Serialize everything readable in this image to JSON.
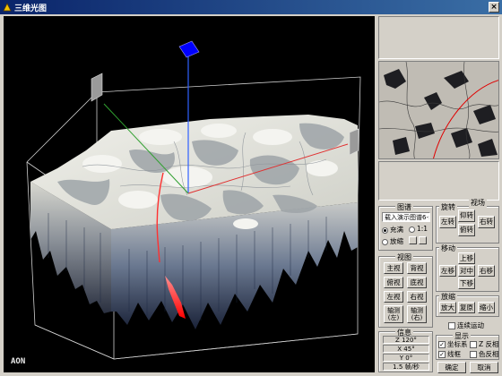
{
  "window": {
    "title": "三维光图",
    "min_glyph": "_",
    "max_glyph": "□",
    "close_glyph": "×"
  },
  "viewport": {
    "corner_label": "AON"
  },
  "colors": {
    "title_bar": "#0a246a",
    "surface": "#e2e0d8",
    "axis_x": "#e03030",
    "axis_y": "#30a030",
    "axis_z": "#3060ff",
    "marker": "#0000ff"
  },
  "controls": {
    "map_group": {
      "label": "图谱",
      "selected_map": "载入演示图谱6->",
      "fill_label": "充满",
      "ratio_label": "1:1",
      "zoom_label": "放缩",
      "fill_selected": true
    },
    "rotate_group": {
      "label": "旋转",
      "left": "左转",
      "up": "仰转",
      "right": "右转",
      "down": "俯转"
    },
    "field_label": "视场",
    "move_group": {
      "label": "移动",
      "up": "上移",
      "left": "左移",
      "center": "对中",
      "right": "右移",
      "down": "下移"
    },
    "view_group": {
      "label": "视图",
      "front": "主视",
      "back": "背视",
      "top": "俯视",
      "bottom": "底视",
      "left": "左视",
      "right": "右视",
      "iso_left": [
        "轴测",
        "(左)"
      ],
      "iso_right": [
        "轴测",
        "(右)"
      ]
    },
    "zoom_group": {
      "label": "放缩",
      "enlarge": "放大",
      "reset": "复原",
      "shrink": "缩小"
    },
    "continuous_label": "连续运动",
    "info_group": {
      "label": "信息",
      "rows": [
        "Z 120°",
        "X 45°",
        "Y 0°",
        "1.5 帧/秒"
      ]
    },
    "display_group": {
      "label": "显示",
      "axes": "坐标系",
      "z_invert": "Z 反相",
      "frame": "线框",
      "color_invert": "色反相",
      "axes_checked": true,
      "z_invert_checked": false,
      "frame_checked": true,
      "color_invert_checked": false
    },
    "ok": "确定",
    "cancel": "取消"
  }
}
